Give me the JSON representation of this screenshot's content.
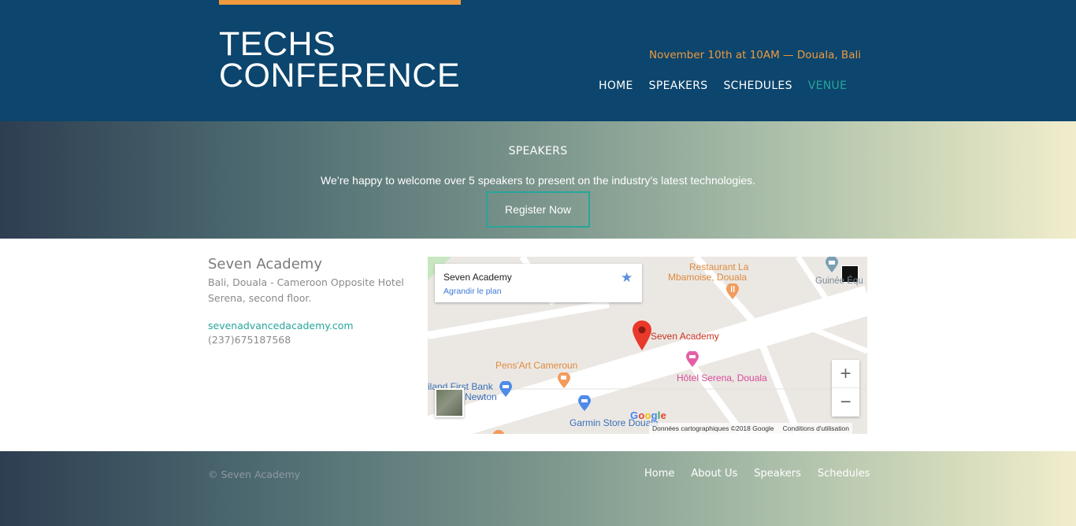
{
  "header": {
    "logo_line1": "TECHS",
    "logo_line2": "CONFERENCE",
    "event_info": "November 10th at 10AM — Douala, Bali",
    "nav": [
      {
        "label": "HOME"
      },
      {
        "label": "SPEAKERS"
      },
      {
        "label": "SCHEDULES"
      },
      {
        "label": "VENUE"
      }
    ],
    "active_nav": "VENUE",
    "accent_color": "#ef9a3e",
    "background_color": "#0c456d"
  },
  "hero": {
    "heading": "SPEAKERS",
    "lead": "We’re happy to welcome over 5 speakers to present on the industry’s latest technologies.",
    "register_label": "Register Now"
  },
  "venue": {
    "name": "Seven Academy",
    "address": "Bali, Douala - Cameroon Opposite Hotel Serena, second floor.",
    "website": "sevenadvancedacademy.com",
    "phone": "(237)675187568"
  },
  "map": {
    "card_title": "Seven Academy",
    "card_link": "Agrandir le plan",
    "marker_label": "Seven Academy",
    "poi": {
      "restaurant_line1": "Restaurant La",
      "restaurant_line2": "Mbamoise, Douala",
      "guinee": "Guinée Équ",
      "pensart": "Pens'Art Cameroun",
      "bank_line1": "riland First Bank",
      "bank_line2": "Newton",
      "hotel": "Hôtel Serena, Douala",
      "garmin": "Garmin Store Douala"
    },
    "zoom_in": "+",
    "zoom_out": "−",
    "attribution": "Données cartographiques ©2018 Google",
    "terms": "Conditions d'utilisation",
    "logo_letters": [
      "G",
      "o",
      "o",
      "g",
      "l",
      "e"
    ]
  },
  "footer": {
    "copyright": "© Seven Academy",
    "links": [
      {
        "label": "Home"
      },
      {
        "label": "About Us"
      },
      {
        "label": "Speakers"
      },
      {
        "label": "Schedules"
      }
    ]
  }
}
